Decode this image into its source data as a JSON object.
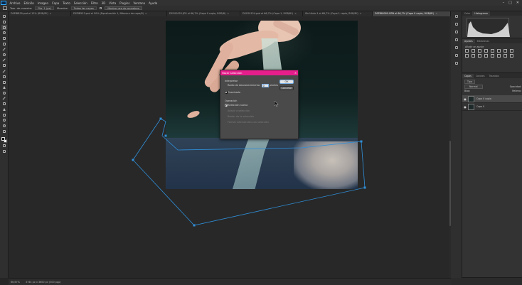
{
  "menubar": {
    "items": [
      "Archivo",
      "Edición",
      "Imagen",
      "Capa",
      "Texto",
      "Selección",
      "Filtro",
      "3D",
      "Vista",
      "Plugins",
      "Ventana",
      "Ayuda"
    ],
    "window_controls": [
      "–",
      "□",
      "✕"
    ]
  },
  "options_bar": {
    "tolerance_label": "Tam. de muestra:",
    "tolerance_value": "Pto. 1 (px)",
    "sample_label": "Muestra:",
    "sample_value": "Todas las capas",
    "button_label": "Mostrar aro de muestreo"
  },
  "tabs": [
    {
      "label": "DSPIBB39.psd al 12% (RGB/8*)",
      "active": false
    },
    {
      "label": "DSPIB553.psd al 50% (Equalización 1, Máscara de capa/8)",
      "active": false
    },
    {
      "label": "DSC00025.JPG al 66,7% (Capa 0 copia, RGB/8)",
      "active": false
    },
    {
      "label": "DSC00124.psd al 66,7% (Capa 1, RGB/8*)",
      "active": false
    },
    {
      "label": "Sin título-1 al 66,7% (Capa 1 copia, RGB/8*)",
      "active": false
    },
    {
      "label": "DSPIB0089.GPN al 66,7% (Capa 0 copia, RGB/8*)",
      "active": true
    }
  ],
  "dialog": {
    "title": "Hacer selección",
    "close": "✕",
    "render_heading": "Interpretar",
    "feather_label": "Radio de desvanecimiento:",
    "feather_value": "0",
    "feather_unit": "píxeles",
    "antialias_label": "Suavizado",
    "operation_heading": "Operación",
    "options": [
      "Selección nueva",
      "Añadir a selección",
      "Restar de la selección",
      "Formar intersección con selección"
    ],
    "ok_label": "OK",
    "cancel_label": "Cancelar"
  },
  "panels": {
    "top_tabs": [
      "Color",
      "Histograma"
    ],
    "adjust_tabs": [
      "Ajustes",
      "Bibliotecas"
    ],
    "adjust_title": "Añadir un ajuste",
    "layers_tabs": [
      "Capas",
      "Canales",
      "Trazados"
    ],
    "layers_kind": "Tipo",
    "blend_mode": "Normal",
    "opacity_label": "Opacidad:",
    "lock_label": "Bloq:",
    "fill_label": "Relleno:",
    "layers": [
      {
        "name": "Capa 0 copia",
        "selected": true
      },
      {
        "name": "Capa 0",
        "selected": false
      }
    ]
  },
  "status": {
    "zoom": "66,67%",
    "doc_info": "3744 px x 3600 px (300 ppp)"
  },
  "colors": {
    "dialog_title": "#e61e8c",
    "path_stroke": "#2f8fd9"
  }
}
